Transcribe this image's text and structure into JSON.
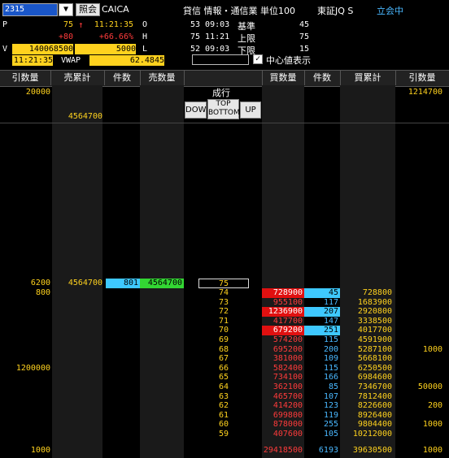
{
  "header": {
    "code": "2315",
    "dropdown_icon": "▼",
    "query_label": "照会",
    "name": "CAICA",
    "category": "貸信 情報・通信業 単位100",
    "market": "東証JQ S",
    "status": "立会中"
  },
  "quote": {
    "p_label": "P",
    "price": "75",
    "arrow": "↑",
    "time": "11:21:35",
    "change": "+80",
    "change_pct": "+66.66%",
    "v_label": "V",
    "volume": "140068500",
    "unit_vol": "5000",
    "vwap_time": "11:21:35",
    "vwap_label": "VWAP",
    "vwap": "62.4845",
    "o_label": "O",
    "o_val": "53 09:03",
    "h_label": "H",
    "h_val": "75 11:21",
    "l_label": "L",
    "l_val": "52 09:03",
    "base_label": "基準",
    "base_val": "45",
    "upper_label": "上限",
    "upper_val": "75",
    "lower_label": "下限",
    "lower_val": "15",
    "center_label": "中心値表示",
    "center_checked": "✓"
  },
  "columns": [
    "引数量",
    "売累計",
    "件数",
    "売数量",
    "",
    "買数量",
    "件数",
    "買累計",
    "引数量"
  ],
  "controls": {
    "market_order_label": "成行",
    "down_label": "DOWN",
    "top_label": "TOP",
    "bottom_label": "BOTTOM",
    "up_label": "UP"
  },
  "top_rows": {
    "sell_close_qty": "20000",
    "buy_close_qty": "1214700",
    "sell_cumulative": "4564700"
  },
  "sell_row": {
    "close_qty": "6200",
    "cumulative": "4564700",
    "count": "801",
    "qty": "4564700",
    "price": "75"
  },
  "book": [
    {
      "close_sell": "800",
      "price": "74",
      "buy_qty": "728900",
      "count": "45",
      "cum": "728800",
      "close_buy": "",
      "hl_qty": true,
      "hl_cnt": true
    },
    {
      "close_sell": "",
      "price": "73",
      "buy_qty": "955100",
      "count": "117",
      "cum": "1683900",
      "close_buy": "",
      "hl_qty": false,
      "hl_cnt": false
    },
    {
      "close_sell": "",
      "price": "72",
      "buy_qty": "1236900",
      "count": "207",
      "cum": "2920800",
      "close_buy": "",
      "hl_qty": true,
      "hl_cnt": true
    },
    {
      "close_sell": "",
      "price": "71",
      "buy_qty": "417700",
      "count": "147",
      "cum": "3338500",
      "close_buy": "",
      "hl_qty": false,
      "hl_cnt": false
    },
    {
      "close_sell": "",
      "price": "70",
      "buy_qty": "679200",
      "count": "251",
      "cum": "4017700",
      "close_buy": "",
      "hl_qty": true,
      "hl_cnt": true
    },
    {
      "close_sell": "",
      "price": "69",
      "buy_qty": "574200",
      "count": "115",
      "cum": "4591900",
      "close_buy": "",
      "hl_qty": false,
      "hl_cnt": false
    },
    {
      "close_sell": "",
      "price": "68",
      "buy_qty": "695200",
      "count": "200",
      "cum": "5287100",
      "close_buy": "1000",
      "hl_qty": false,
      "hl_cnt": false
    },
    {
      "close_sell": "",
      "price": "67",
      "buy_qty": "381000",
      "count": "109",
      "cum": "5668100",
      "close_buy": "",
      "hl_qty": false,
      "hl_cnt": false
    },
    {
      "close_sell": "1200000",
      "price": "66",
      "buy_qty": "582400",
      "count": "115",
      "cum": "6250500",
      "close_buy": "",
      "hl_qty": false,
      "hl_cnt": false
    },
    {
      "close_sell": "",
      "price": "65",
      "buy_qty": "734100",
      "count": "166",
      "cum": "6984600",
      "close_buy": "",
      "hl_qty": false,
      "hl_cnt": false
    },
    {
      "close_sell": "",
      "price": "64",
      "buy_qty": "362100",
      "count": "85",
      "cum": "7346700",
      "close_buy": "50000",
      "hl_qty": false,
      "hl_cnt": false
    },
    {
      "close_sell": "",
      "price": "63",
      "buy_qty": "465700",
      "count": "107",
      "cum": "7812400",
      "close_buy": "",
      "hl_qty": false,
      "hl_cnt": false
    },
    {
      "close_sell": "",
      "price": "62",
      "buy_qty": "414200",
      "count": "123",
      "cum": "8226600",
      "close_buy": "200",
      "hl_qty": false,
      "hl_cnt": false
    },
    {
      "close_sell": "",
      "price": "61",
      "buy_qty": "699800",
      "count": "119",
      "cum": "8926400",
      "close_buy": "",
      "hl_qty": false,
      "hl_cnt": false
    },
    {
      "close_sell": "",
      "price": "60",
      "buy_qty": "878000",
      "count": "255",
      "cum": "9804400",
      "close_buy": "1000",
      "hl_qty": false,
      "hl_cnt": false
    },
    {
      "close_sell": "",
      "price": "59",
      "buy_qty": "407600",
      "count": "105",
      "cum": "10212000",
      "close_buy": "",
      "hl_qty": false,
      "hl_cnt": false
    }
  ],
  "footer": {
    "close_sell": "1000",
    "buy_qty_total": "29418500",
    "count_total": "6193",
    "cum_total": "39630500",
    "close_buy": "1000"
  },
  "colors": {
    "sell_count_bg": "#3ec8ff",
    "sell_qty_bg": "#33d633",
    "buy_hl_bg": "#e01010",
    "count_hl_bg": "#3ec8ff",
    "accent_yellow": "#ffd21e"
  }
}
